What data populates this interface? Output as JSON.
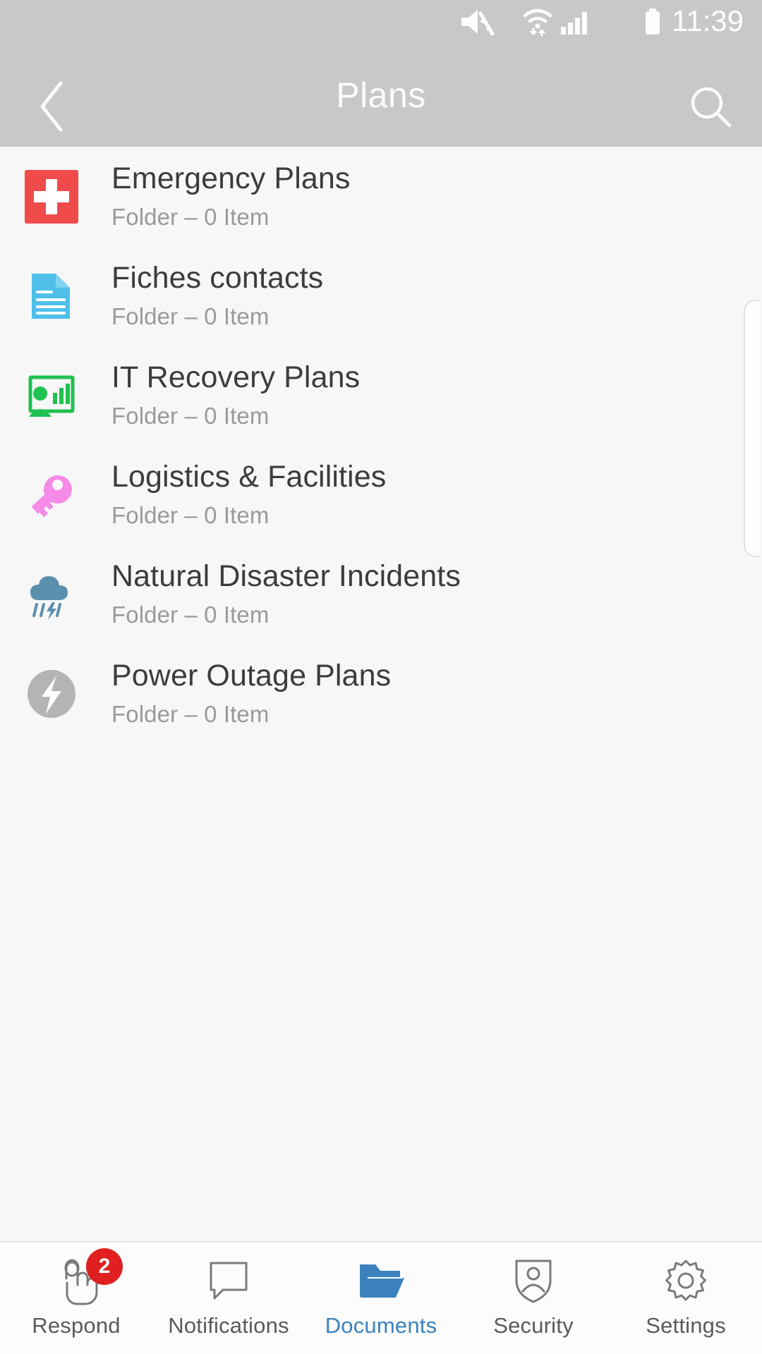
{
  "statusbar": {
    "time": "11:39",
    "icons": [
      "mute-icon",
      "wifi-icon",
      "cellular-signal-icon",
      "battery-icon"
    ]
  },
  "appbar": {
    "title": "Plans",
    "back_icon": "chevron-left-icon",
    "search_icon": "search-icon"
  },
  "list": {
    "items": [
      {
        "title": "Emergency Plans",
        "subtitle": "Folder – 0 Item",
        "icon": "first-aid-cross-icon",
        "color": "#ef4b4b"
      },
      {
        "title": "Fiches contacts",
        "subtitle": "Folder – 0 Item",
        "icon": "document-icon",
        "color": "#4ec0ea"
      },
      {
        "title": "IT Recovery Plans",
        "subtitle": "Folder – 0 Item",
        "icon": "presentation-chart-icon",
        "color": "#1fc14f"
      },
      {
        "title": "Logistics & Facilities",
        "subtitle": "Folder – 0 Item",
        "icon": "key-icon",
        "color": "#f58be8"
      },
      {
        "title": "Natural Disaster Incidents",
        "subtitle": "Folder – 0 Item",
        "icon": "storm-cloud-icon",
        "color": "#5b8fae"
      },
      {
        "title": "Power Outage Plans",
        "subtitle": "Folder – 0 Item",
        "icon": "power-bolt-icon",
        "color": "#b4b4b4"
      }
    ]
  },
  "bottomnav": {
    "active_color": "#3b82bd",
    "items": [
      {
        "label": "Respond",
        "icon": "tap-hand-icon",
        "badge": "2",
        "active": false
      },
      {
        "label": "Notifications",
        "icon": "speech-bubble-icon",
        "badge": null,
        "active": false
      },
      {
        "label": "Documents",
        "icon": "open-folder-icon",
        "badge": null,
        "active": true
      },
      {
        "label": "Security",
        "icon": "shield-person-icon",
        "badge": null,
        "active": false
      },
      {
        "label": "Settings",
        "icon": "gear-icon",
        "badge": null,
        "active": false
      }
    ]
  }
}
